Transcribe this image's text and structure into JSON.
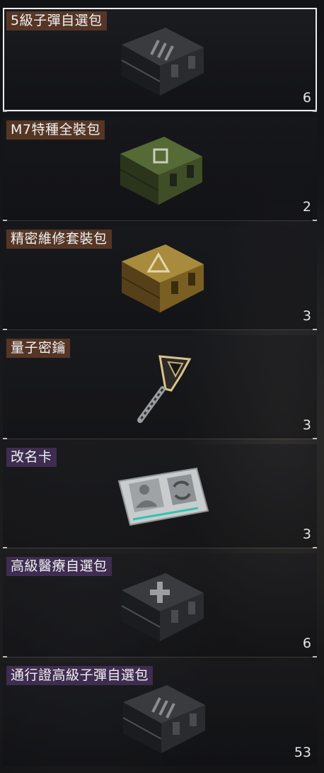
{
  "items": [
    {
      "name": "5級子彈自選包",
      "qty": "6",
      "icon": "dark-crate-icon",
      "tag_color": "#603c28"
    },
    {
      "name": "M7特種全裝包",
      "qty": "2",
      "icon": "green-crate-icon",
      "tag_color": "#603c28"
    },
    {
      "name": "精密維修套裝包",
      "qty": "3",
      "icon": "gold-crate-icon",
      "tag_color": "#603c28"
    },
    {
      "name": "量子密鑰",
      "qty": "3",
      "icon": "key-icon",
      "tag_color": "#603c28"
    },
    {
      "name": "改名卡",
      "qty": "3",
      "icon": "rename-card-icon",
      "tag_color": "#423056"
    },
    {
      "name": "高級醫療自選包",
      "qty": "6",
      "icon": "medical-crate-icon",
      "tag_color": "#423056"
    },
    {
      "name": "通行證高級子彈自選包",
      "qty": "53",
      "icon": "dark-crate-icon",
      "tag_color": "#423056"
    }
  ]
}
